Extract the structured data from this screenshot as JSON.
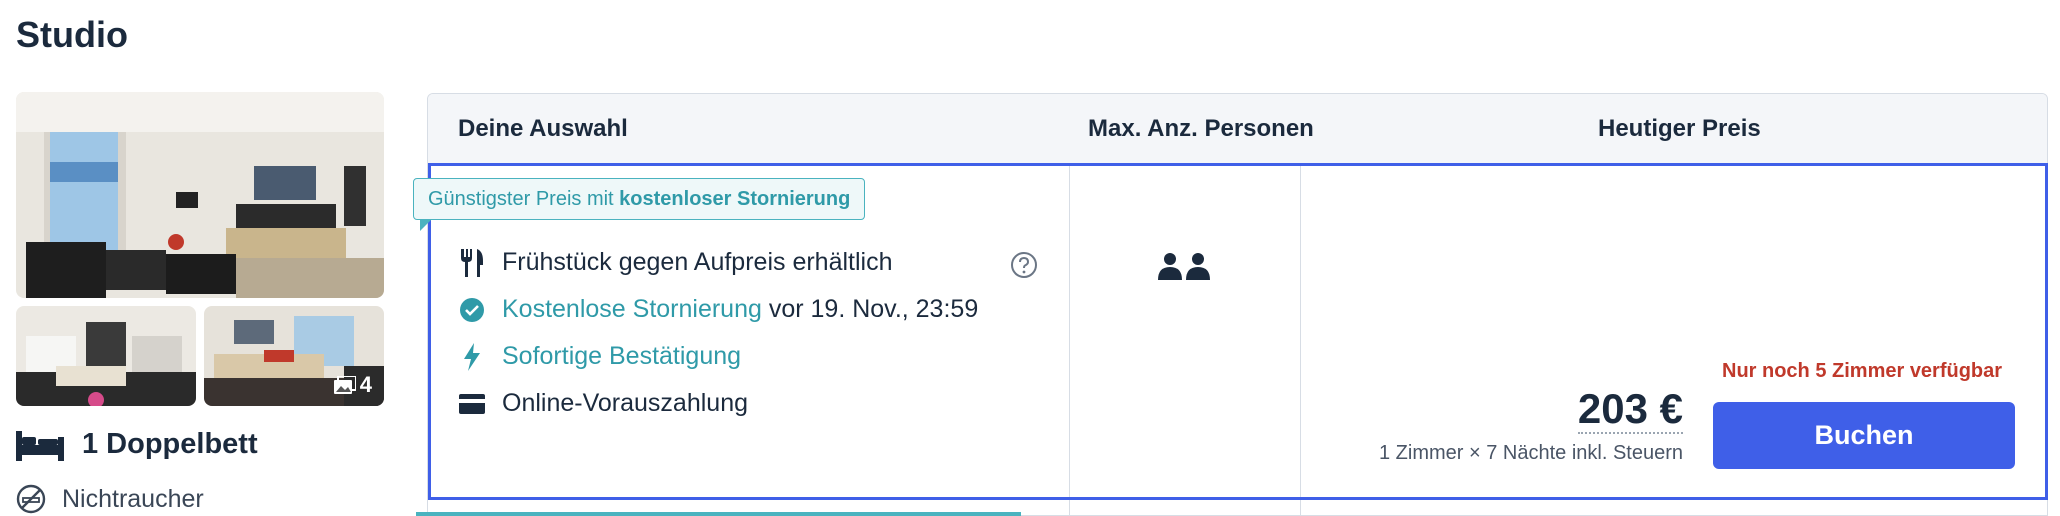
{
  "room": {
    "title": "Studio",
    "photo_count": "4",
    "bed_label": "1 Doppelbett",
    "smoking_label": "Nichtraucher"
  },
  "table": {
    "headers": {
      "choice": "Deine Auswahl",
      "persons": "Max. Anz. Personen",
      "price": "Heutiger Preis"
    }
  },
  "offer": {
    "badge_prefix": "Günstigster Preis mit ",
    "badge_strong": "kostenloser Stornierung",
    "features": {
      "breakfast": "Frühstück gegen Aufpreis erhältlich",
      "cancellation_link": "Kostenlose Stornierung",
      "cancellation_date": "vor 19. Nov., 23:59",
      "confirmation": "Sofortige Bestätigung",
      "payment": "Online-Vorauszahlung"
    },
    "max_persons": 2,
    "availability": "Nur noch 5 Zimmer verfügbar",
    "price": "203 €",
    "price_note": "1 Zimmer × 7 Nächte inkl. Steuern",
    "book_label": "Buchen"
  },
  "colors": {
    "accent_blue": "#3f5fe8",
    "teal": "#2f9aa8",
    "warning_red": "#c0392b",
    "text_dark": "#1b2a3d"
  },
  "icons": {
    "breakfast": "fork-knife-icon",
    "cancellation": "check-circle-icon",
    "confirmation": "lightning-icon",
    "payment": "credit-card-icon",
    "help": "question-circle-icon",
    "persons": "two-persons-icon",
    "bed": "bed-icon",
    "nosmoke": "no-smoking-icon",
    "gallery": "images-icon"
  }
}
